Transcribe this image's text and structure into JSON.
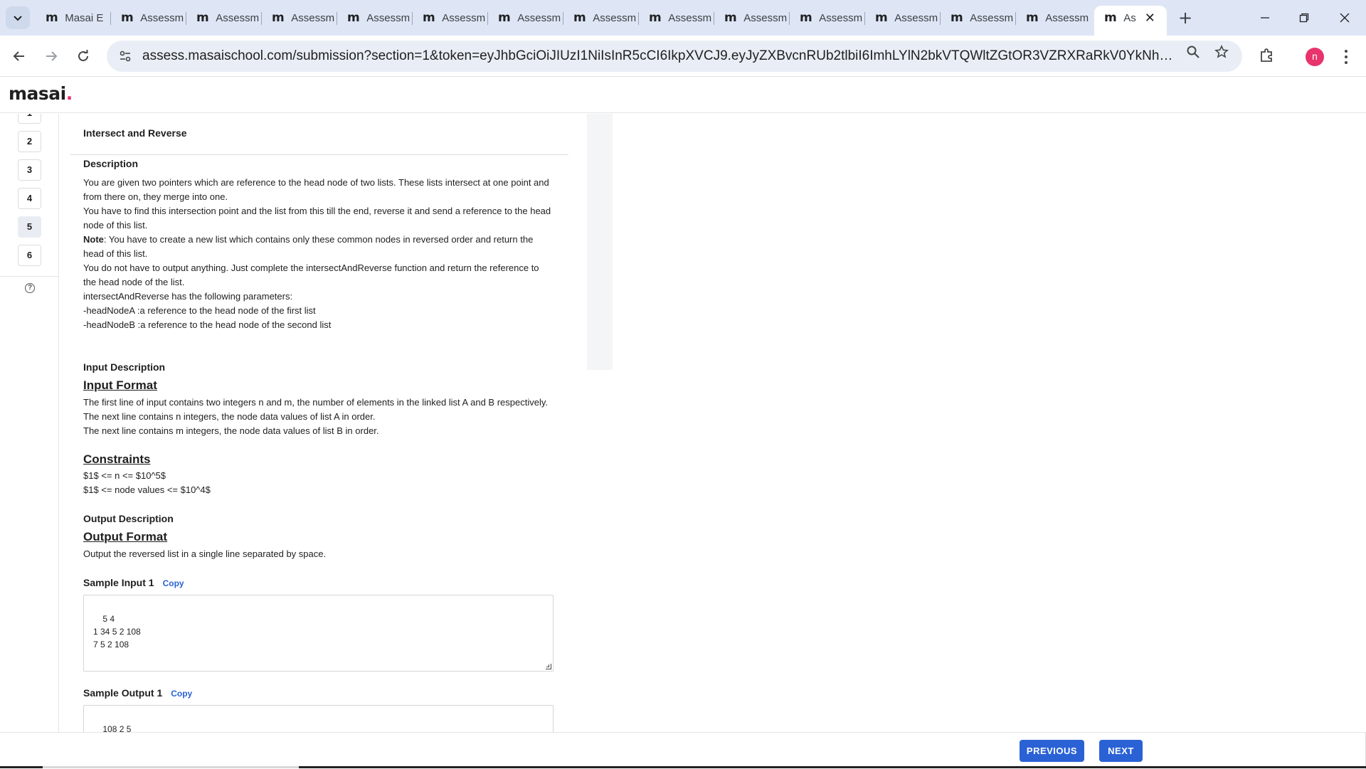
{
  "browser": {
    "tabs": [
      {
        "title": "Masai E"
      },
      {
        "title": "Assessm"
      },
      {
        "title": "Assessm"
      },
      {
        "title": "Assessm"
      },
      {
        "title": "Assessm"
      },
      {
        "title": "Assessm"
      },
      {
        "title": "Assessm"
      },
      {
        "title": "Assessm"
      },
      {
        "title": "Assessm"
      },
      {
        "title": "Assessm"
      },
      {
        "title": "Assessm"
      },
      {
        "title": "Assessm"
      },
      {
        "title": "Assessm"
      },
      {
        "title": "Assessm"
      },
      {
        "title": "As"
      }
    ],
    "favicon_letter": "m",
    "url": "assess.masaischool.com/submission?section=1&token=eyJhbGciOiJIUzI1NiIsInR5cCI6IkpXVCJ9.eyJyZXBvcnRUb2tlbiI6ImhLYlN2bkVTQWltZGtOR3VZRXRaRkV0YkNheGpNQ0FwSnB3SGdyb..."
  },
  "app": {
    "logo_text": "masai",
    "logo_dot": "."
  },
  "question_nav": {
    "items": [
      "1",
      "2",
      "3",
      "4",
      "5",
      "6"
    ],
    "current": "5"
  },
  "question": {
    "title": "Intersect and Reverse",
    "description_heading": "Description",
    "description": [
      "You are given two pointers which are reference to the head node of two lists. These lists intersect at one point and from there on, they merge into one.",
      "You have to find this intersection point and the list from this till the end, reverse it and send a reference to the head node of this list."
    ],
    "note_label": "Note",
    "note_text": ": You have to create a new list which contains only these common nodes in reversed order and return the head of this list.",
    "description_more": [
      "You do not have to output anything. Just complete the intersectAndReverse function and return the reference to the head node of the list.",
      "intersectAndReverse has the following parameters:",
      "-headNodeA :a reference to the head node of the first list",
      "-headNodeB :a reference to the head node of the second list"
    ],
    "input_description_heading": "Input Description",
    "input_format_heading": "Input Format",
    "input_format": [
      "The first line of input contains two integers n and m, the number of elements in the linked list A and B respectively.",
      "The next line contains n integers, the node data values of list A in order.",
      "The next line contains m integers, the node data values of list B in order."
    ],
    "constraints_heading": "Constraints",
    "constraints": [
      "$1$ <= n <= $10^5$",
      "$1$ <= node values <= $10^4$"
    ],
    "output_description_heading": "Output Description",
    "output_format_heading": "Output Format",
    "output_format": "Output the reversed list in a single line separated by space.",
    "sample_input_label": "Sample Input 1",
    "sample_input": "5 4\n1 34 5 2 108\n7 5 2 108",
    "sample_output_label": "Sample Output 1",
    "sample_output": "108 2 5",
    "copy_label": "Copy"
  },
  "footer": {
    "previous_label": "PREVIOUS",
    "next_label": "NEXT"
  },
  "colors": {
    "accent": "#2a62d6",
    "brand_dot": "#e8336d",
    "tabstrip": "#dee6f5"
  }
}
